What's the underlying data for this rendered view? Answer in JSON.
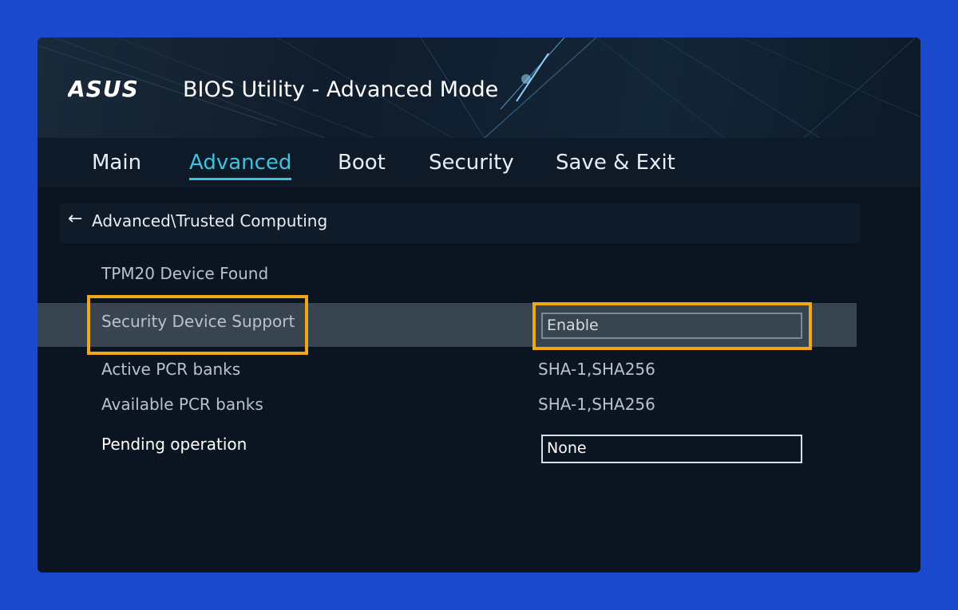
{
  "app": {
    "brand": "ASUS",
    "title": "BIOS Utility - Advanced Mode"
  },
  "tabs": [
    {
      "label": "Main"
    },
    {
      "label": "Advanced",
      "active": true
    },
    {
      "label": "Boot"
    },
    {
      "label": "Security"
    },
    {
      "label": "Save & Exit"
    }
  ],
  "breadcrumb": {
    "back_icon": "back-arrow-icon",
    "path": "Advanced\\Trusted Computing"
  },
  "settings": [
    {
      "label": "TPM20 Device Found",
      "value": ""
    },
    {
      "label": "Security Device Support",
      "value": "Enable",
      "selected": true,
      "highlighted": true
    },
    {
      "label": "Active PCR banks",
      "value": "SHA-1,SHA256"
    },
    {
      "label": "Available PCR banks",
      "value": "SHA-1,SHA256"
    },
    {
      "label": "Pending operation",
      "value": "None"
    }
  ],
  "colors": {
    "page_background": "#1a4acb",
    "accent": "#3fc2dd",
    "highlight": "#f0a818",
    "selected_row": "#38444f"
  }
}
